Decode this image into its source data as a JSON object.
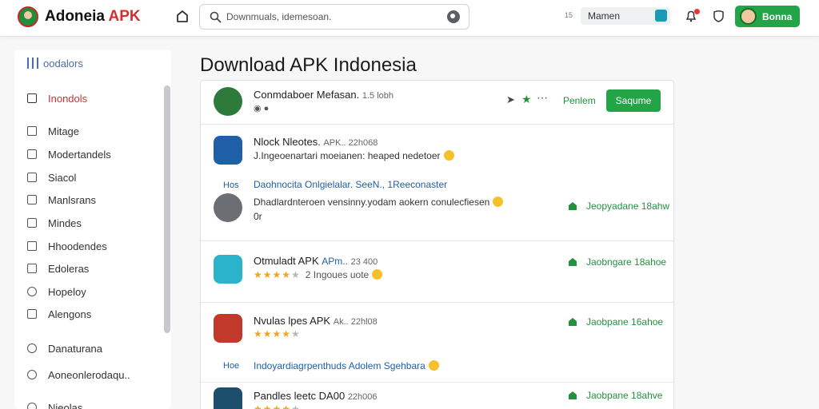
{
  "brand": {
    "name_main": "Adoneia",
    "name_accent": "APK"
  },
  "search": {
    "placeholder": "Downmuals, idemesoan."
  },
  "header": {
    "hash_badge": "15",
    "name_field": "Mamen",
    "user_label": "Bonna",
    "colors": {
      "accent_green": "#23a447",
      "accent_red": "#d32f2f"
    }
  },
  "sidebar": {
    "header": "oodalors",
    "items": [
      {
        "label": "Inondols",
        "icon": "folder-icon",
        "active": true
      },
      {
        "label": "Mitage",
        "icon": "checkbox-icon"
      },
      {
        "label": "Modertandels",
        "icon": "square-icon"
      },
      {
        "label": "Siacol",
        "icon": "square-icon"
      },
      {
        "label": "Manlsrans",
        "icon": "checkbox-icon"
      },
      {
        "label": "Mindes",
        "icon": "minus-square-icon"
      },
      {
        "label": "Hhoodendes",
        "icon": "square-icon"
      },
      {
        "label": "Edoleras",
        "icon": "x-square-icon"
      },
      {
        "label": "Hopeloy",
        "icon": "pin-icon"
      },
      {
        "label": "Alengons",
        "icon": "checkbox-icon"
      },
      {
        "label": "Danaturana",
        "icon": "info-icon"
      },
      {
        "label": "Aoneonlerodaqu..",
        "icon": "clock-icon"
      },
      {
        "label": "Nieolas",
        "icon": "circle-icon"
      }
    ]
  },
  "main": {
    "title": "Download APK Indonesia",
    "top_row": {
      "line1": "Conmdaboer Mefasan.",
      "line1_meta": "1.5 lobh",
      "action_label": "Penlem",
      "button_label": "Saqume"
    },
    "post": {
      "line1": "Nlock Nleotes.",
      "line1_meta": "APK.. 22h068",
      "line2": "J.Ingeoenartari moeianen: heaped nedetoer",
      "badge": "Hos",
      "link": "Daohnocita Onlgielalar. SeeN., 1Reeconaster",
      "comment": "Dhadlardnteroen vensinny.yodam aokern conulecfiesen",
      "comment_line2": "0r",
      "download": "Jeopyadane 18ahw"
    },
    "apps": [
      {
        "title": "Otmuladt APK",
        "title_link": "APm..",
        "meta": "23 400",
        "rating": 4,
        "rating_text": "2  Ingoues uote",
        "download": "Jaobngare 18ahoe"
      },
      {
        "title": "Nvulas lpes APK",
        "meta": "Ak.. 22hl08",
        "rating": 4,
        "download": "Jaobpane 16ahoe",
        "badge": "Hoe",
        "link": "Indoyardiagrpenthuds Adolem Sgehbara"
      },
      {
        "title": "Pandles leetc DA00",
        "meta": "22h006",
        "rating": 4,
        "download": "Jaobpane 18ahve"
      }
    ]
  }
}
